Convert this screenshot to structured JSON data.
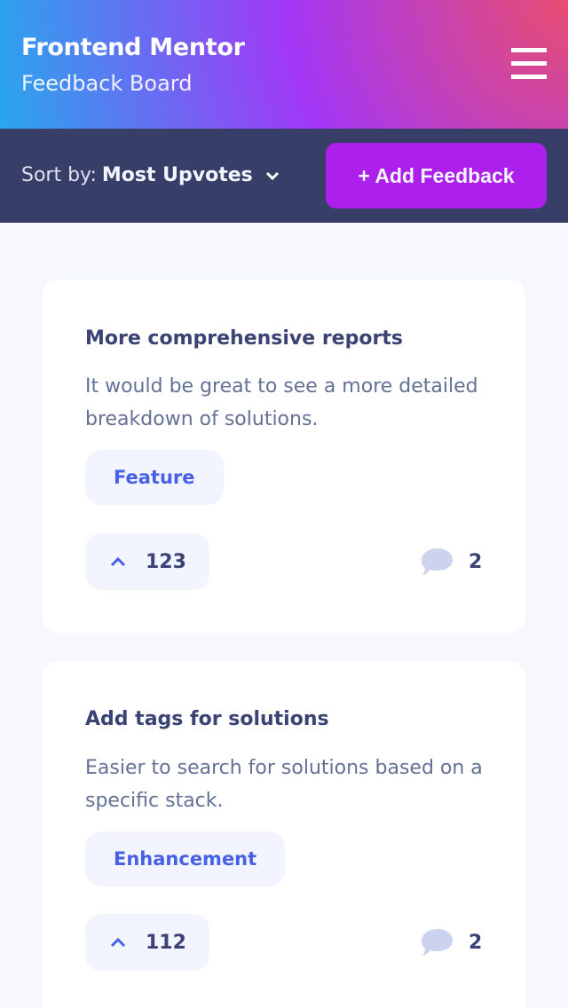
{
  "header": {
    "title": "Frontend Mentor",
    "subtitle": "Feedback Board",
    "menu_icon": "hamburger-menu-icon"
  },
  "toolbar": {
    "sort_label": "Sort by:",
    "sort_value": "Most Upvotes",
    "add_button": "+ Add Feedback"
  },
  "colors": {
    "accent": "#ad1fea",
    "toolbar_bg": "#373f68",
    "link": "#4661e6",
    "page_bg": "#f7f8fd"
  },
  "feedback": [
    {
      "title": "More comprehensive reports",
      "description": "It would be great to see a more detailed breakdown of solutions.",
      "tag": "Feature",
      "upvotes": "123",
      "comments": "2"
    },
    {
      "title": "Add tags for solutions",
      "description": "Easier to search for solutions based on a specific stack.",
      "tag": "Enhancement",
      "upvotes": "112",
      "comments": "2"
    }
  ]
}
